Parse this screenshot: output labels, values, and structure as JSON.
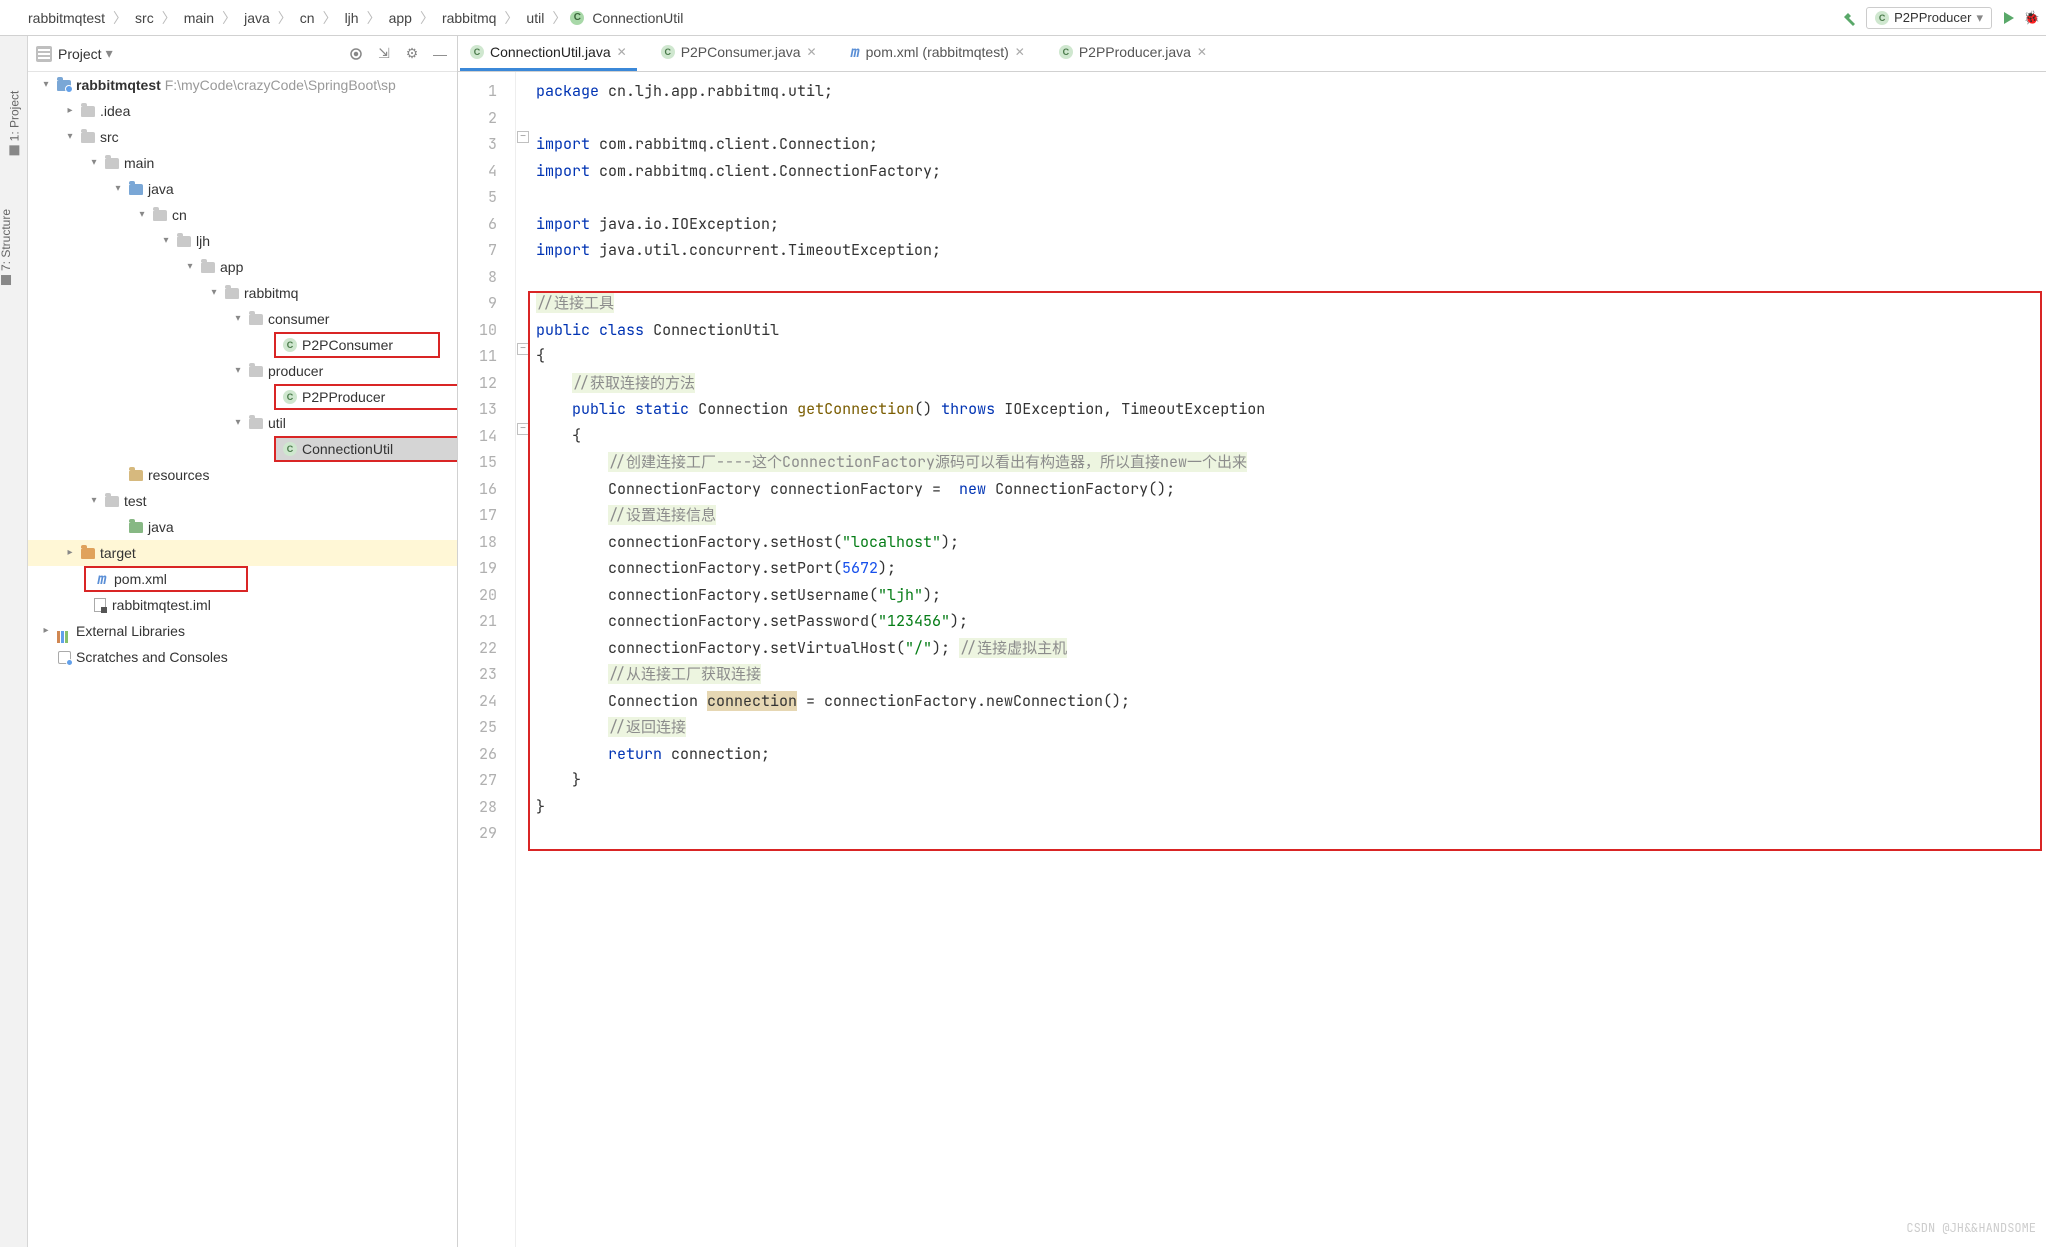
{
  "breadcrumbs": [
    "rabbitmqtest",
    "src",
    "main",
    "java",
    "cn",
    "ljh",
    "app",
    "rabbitmq",
    "util",
    "ConnectionUtil"
  ],
  "run_config": "P2PProducer",
  "sidebar": {
    "title": "Project",
    "root": {
      "name": "rabbitmqtest",
      "path": "F:\\myCode\\crazyCode\\SpringBoot\\sp"
    },
    "idea": ".idea",
    "src": "src",
    "main": "main",
    "java": "java",
    "cn": "cn",
    "ljh": "ljh",
    "app": "app",
    "rabbitmq": "rabbitmq",
    "consumer": "consumer",
    "p2pconsumer": "P2PConsumer",
    "producer": "producer",
    "p2pproducer": "P2PProducer",
    "util": "util",
    "connectionutil": "ConnectionUtil",
    "resources": "resources",
    "test": "test",
    "java2": "java",
    "target": "target",
    "pom": "pom.xml",
    "iml": "rabbitmqtest.iml",
    "extlib": "External Libraries",
    "scratch": "Scratches and Consoles"
  },
  "left_labels": {
    "project": "1: Project",
    "structure": "7: Structure"
  },
  "tabs": [
    {
      "label": "ConnectionUtil.java",
      "icon": "class",
      "active": true
    },
    {
      "label": "P2PConsumer.java",
      "icon": "class",
      "active": false
    },
    {
      "label": "pom.xml (rabbitmqtest)",
      "icon": "m",
      "active": false
    },
    {
      "label": "P2PProducer.java",
      "icon": "class",
      "active": false
    }
  ],
  "code": {
    "package": "package",
    "pkg_path": "cn.ljh.app.rabbitmq.util;",
    "import": "import",
    "imp1": "com.rabbitmq.client.Connection;",
    "imp2": "com.rabbitmq.client.ConnectionFactory;",
    "imp3": "java.io.IOException;",
    "imp4": "java.util.concurrent.TimeoutException;",
    "c1": "//连接工具",
    "public": "public",
    "class": "class",
    "static": "static",
    "throws": "throws",
    "new": "new",
    "return": "return",
    "cls_name": "ConnectionUtil",
    "lbrace": "{",
    "rbrace": "}",
    "c2": "//获取连接的方法",
    "ret_type": "Connection",
    "m_name": "getConnection",
    "parens": "()",
    "ex1": "IOException,",
    "ex2": "TimeoutException",
    "c3": "//创建连接工厂----这个ConnectionFactory源码可以看出有构造器，所以直接new一个出来",
    "l16a": "ConnectionFactory connectionFactory = ",
    "l16b": " ConnectionFactory();",
    "c4": "//设置连接信息",
    "l18": "connectionFactory.setHost(",
    "s18": "\"localhost\"",
    "l18e": ");",
    "l19": "connectionFactory.setPort(",
    "n19": "5672",
    "l19e": ");",
    "l20": "connectionFactory.setUsername(",
    "s20": "\"ljh\"",
    "l20e": ");",
    "l21": "connectionFactory.setPassword(",
    "s21": "\"123456\"",
    "l21e": ");",
    "l22": "connectionFactory.setVirtualHost(",
    "s22": "\"/\"",
    "l22e": "); ",
    "c5": "//连接虚拟主机",
    "c6": "//从连接工厂获取连接",
    "l24a": "Connection ",
    "l24b": "connection",
    "l24c": " = connectionFactory.newConnection();",
    "c7": "//返回连接",
    "l26": " connection;"
  },
  "watermark": "CSDN @JH&&HANDSOME"
}
